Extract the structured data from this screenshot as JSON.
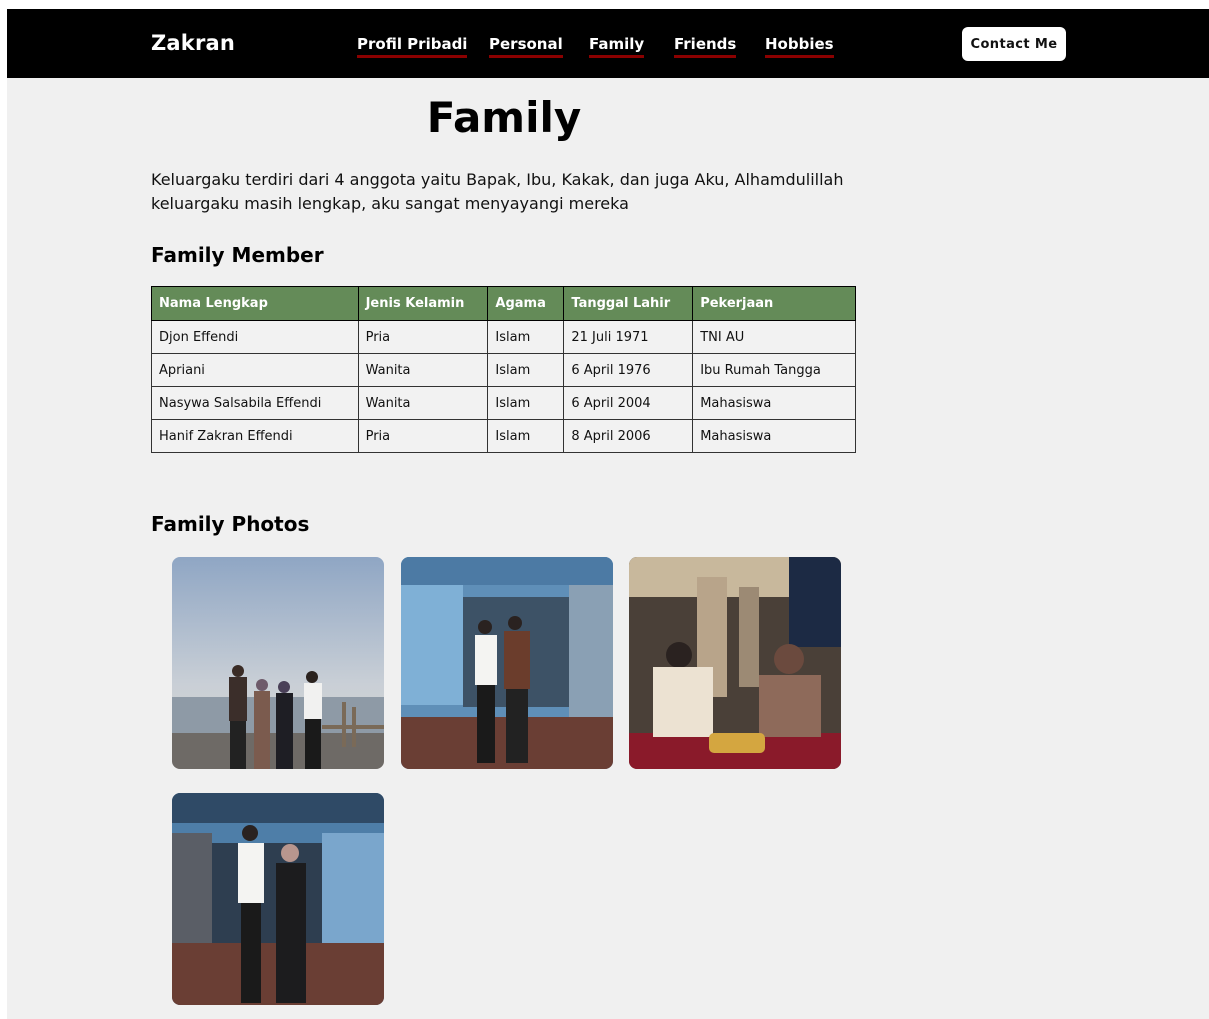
{
  "nav": {
    "brand": "Zakran",
    "links": [
      "Profil Pribadi",
      "Personal",
      "Family",
      "Friends",
      "Hobbies"
    ],
    "contact_label": "Contact Me",
    "accent_underline": "#8b0000"
  },
  "main": {
    "title": "Family",
    "intro": "Keluargaku terdiri dari 4 anggota yaitu Bapak, Ibu, Kakak, dan juga Aku, Alhamdulillah keluargaku masih lengkap, aku sangat menyayangi mereka"
  },
  "members": {
    "heading": "Family Member",
    "header_color": "#648b58",
    "columns": [
      "Nama Lengkap",
      "Jenis Kelamin",
      "Agama",
      "Tanggal Lahir",
      "Pekerjaan"
    ],
    "rows": [
      [
        "Djon Effendi",
        "Pria",
        "Islam",
        "21 Juli 1971",
        "TNI AU"
      ],
      [
        "Apriani",
        "Wanita",
        "Islam",
        "6 April 1976",
        "Ibu Rumah Tangga"
      ],
      [
        "Nasywa Salsabila Effendi",
        "Wanita",
        "Islam",
        "6 April 2004",
        "Mahasiswa"
      ],
      [
        "Hanif Zakran Effendi",
        "Pria",
        "Islam",
        "8 April 2006",
        "Mahasiswa"
      ]
    ]
  },
  "photos": {
    "heading": "Family Photos",
    "items": [
      "family-photo-seaside",
      "family-photo-house-father-son",
      "family-photo-restaurant",
      "family-photo-house-siblings"
    ]
  }
}
